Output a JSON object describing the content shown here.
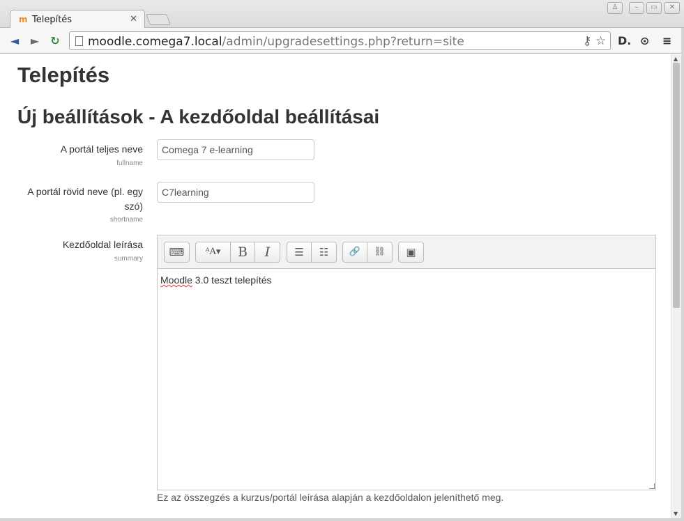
{
  "browser": {
    "tab_title": "Telepítés",
    "tab_close": "✕",
    "url_host": "moodle.comega7.local",
    "url_path": "/admin/upgradesettings.php?return=site",
    "window_buttons": {
      "user": "♙",
      "minimize": "–",
      "maximize": "▭",
      "close": "✕"
    },
    "nav": {
      "back": "◄",
      "forward": "►",
      "reload": "↻"
    },
    "omnibox_icons": {
      "key": "⚷",
      "star": "☆"
    },
    "extensions": {
      "ext1": "D.",
      "ext2": "⊙",
      "menu": "≡"
    }
  },
  "page": {
    "title": "Telepítés",
    "section_title": "Új beállítások - A kezdőoldal beállításai"
  },
  "form": {
    "fullname": {
      "label": "A portál teljes neve",
      "sub": "fullname",
      "value": "Comega 7 e-learning"
    },
    "shortname": {
      "label": "A portál rövid neve (pl. egy szó)",
      "sub": "shortname",
      "value": "C7learning"
    },
    "summary": {
      "label": "Kezdőoldal leírása",
      "sub": "summary",
      "content_word1": "Moodle",
      "content_rest": " 3.0 teszt telepítés",
      "helper": "Ez az összegzés a kurzus/portál leírása alapján a kezdőoldalon jeleníthető meg."
    }
  },
  "editor_toolbar": {
    "toggle": "⌨",
    "font": "ᴬA▾",
    "bold": "B",
    "italic": "I",
    "ul": "☰",
    "ol": "☷",
    "link": "🔗",
    "unlink": "⛓",
    "image": "▣"
  },
  "colors": {
    "accent_reload": "#2e8b3a",
    "favicon": "#f08a24"
  }
}
